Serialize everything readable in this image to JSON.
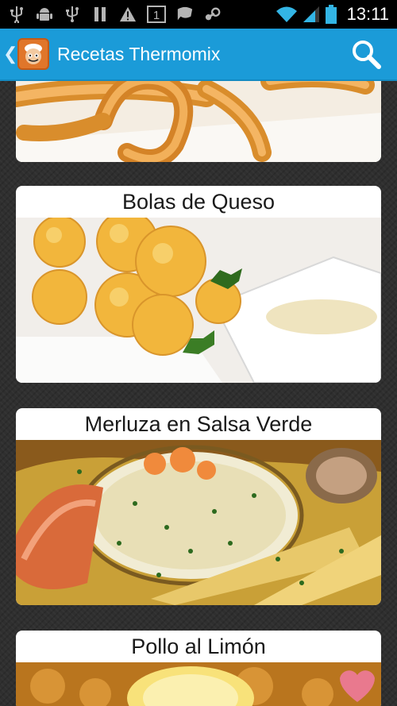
{
  "status_bar": {
    "time": "13:11",
    "notification_badge": "1",
    "icons": [
      "usb-icon",
      "android-debug-icon",
      "usb-icon",
      "pause-icon",
      "warning-icon",
      "notification-count-icon",
      "chat-icon",
      "steam-icon"
    ]
  },
  "action_bar": {
    "title": "Recetas Thermomix",
    "accent_color": "#1b9bd8"
  },
  "recipes": [
    {
      "title": ""
    },
    {
      "title": "Bolas de Queso"
    },
    {
      "title": "Merluza en Salsa Verde"
    },
    {
      "title": "Pollo al Limón"
    }
  ]
}
